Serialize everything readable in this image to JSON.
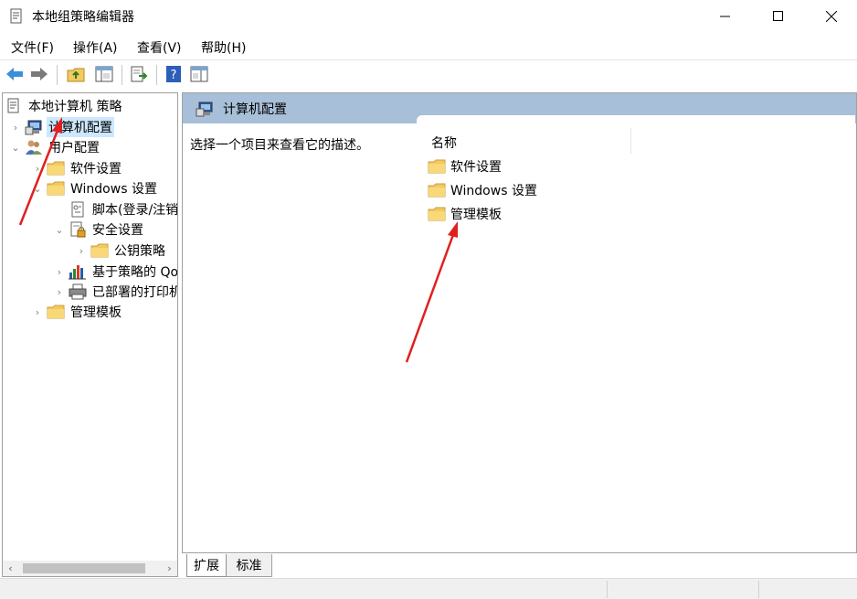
{
  "window": {
    "title": "本地组策略编辑器",
    "controls": {
      "minimize": "minimize",
      "maximize": "maximize",
      "close": "close"
    }
  },
  "menu": [
    {
      "label": "文件(F)"
    },
    {
      "label": "操作(A)"
    },
    {
      "label": "查看(V)"
    },
    {
      "label": "帮助(H)"
    }
  ],
  "toolbar": {
    "buttons": [
      "back-icon",
      "forward-icon",
      "up-folder-icon",
      "show-hide-tree-icon",
      "export-list-icon",
      "help-icon",
      "properties-pane-icon"
    ]
  },
  "tree": {
    "items": [
      {
        "label": "本地计算机 策略",
        "icon": "policy-doc-icon",
        "expander": ""
      },
      {
        "label": "计算机配置",
        "icon": "computer-icon",
        "expander": "›",
        "selected": true
      },
      {
        "label": "用户配置",
        "icon": "users-icon",
        "expander": "⌄"
      },
      {
        "label": "软件设置",
        "icon": "folder-icon",
        "expander": "›"
      },
      {
        "label": "Windows 设置",
        "icon": "folder-icon",
        "expander": "⌄"
      },
      {
        "label": "脚本(登录/注销)",
        "icon": "script-icon",
        "expander": ""
      },
      {
        "label": "安全设置",
        "icon": "security-icon",
        "expander": "⌄"
      },
      {
        "label": "公钥策略",
        "icon": "folder-icon",
        "expander": "›"
      },
      {
        "label": "基于策略的 QoS",
        "icon": "chart-icon",
        "expander": "›"
      },
      {
        "label": "已部署的打印机",
        "icon": "printer-icon",
        "expander": "›"
      },
      {
        "label": "管理模板",
        "icon": "folder-icon",
        "expander": "›"
      }
    ],
    "scroll": {
      "left": "‹",
      "right": "›"
    }
  },
  "content": {
    "header_title": "计算机配置",
    "description": "选择一个项目来查看它的描述。",
    "column_name": "名称",
    "items": [
      {
        "label": "软件设置",
        "icon": "folder-icon"
      },
      {
        "label": "Windows 设置",
        "icon": "folder-icon"
      },
      {
        "label": "管理模板",
        "icon": "folder-icon"
      }
    ]
  },
  "tabs": [
    {
      "label": "扩展",
      "active": true
    },
    {
      "label": "标准",
      "active": false
    }
  ],
  "colors": {
    "header_bg": "#a7bfd8",
    "selection_bg": "#cce8ff",
    "annotation_arrow": "#e02020",
    "folder": "#f4c95d"
  }
}
